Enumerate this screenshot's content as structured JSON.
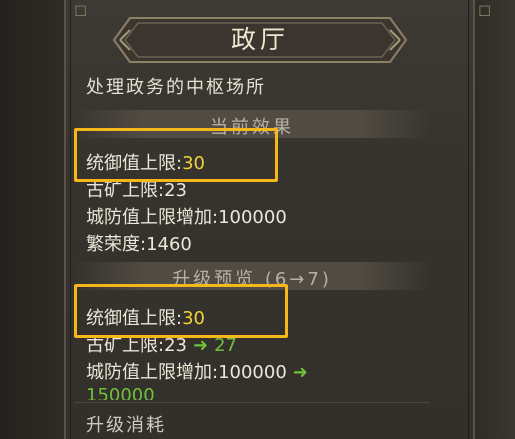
{
  "panel": {
    "title": "政厅",
    "description": "处理政务的中枢场所"
  },
  "current_effect": {
    "section_title": "当前效果",
    "stats": [
      {
        "label": "统御值上限:",
        "value": "30"
      },
      {
        "label": "古矿上限:",
        "value": "23"
      },
      {
        "label": "城防值上限增加:",
        "value": "100000"
      },
      {
        "label": "繁荣度:",
        "value": "1460"
      }
    ]
  },
  "upgrade_preview": {
    "section_title": "升级预览 (6→7)",
    "stats": [
      {
        "label": "统御值上限:",
        "value": "30",
        "new_value": ""
      },
      {
        "label": "古矿上限:",
        "value": "23",
        "new_value": "27"
      },
      {
        "label": "城防值上限增加:",
        "value": "100000",
        "new_value": "150000"
      }
    ]
  },
  "upgrade_cost": {
    "section_title": "升级消耗"
  },
  "colors": {
    "highlight": "#f7b61a",
    "value_yellow": "#f2d23c",
    "value_green": "#6fc13b"
  }
}
